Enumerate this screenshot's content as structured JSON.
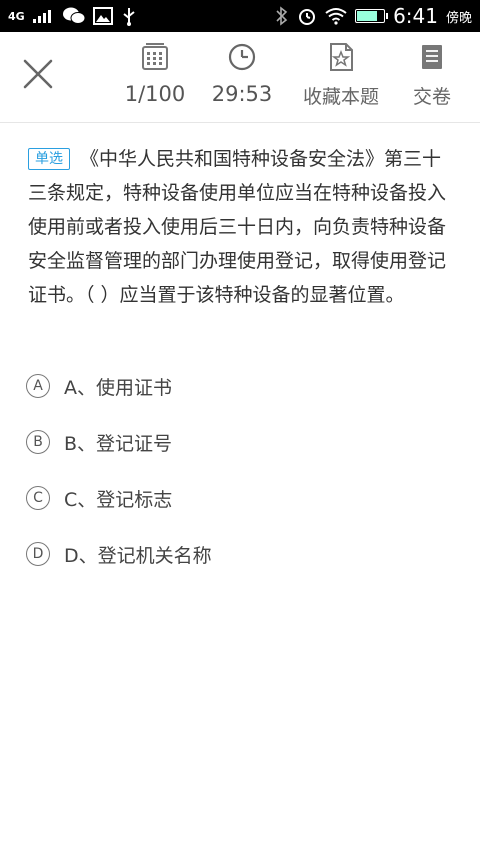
{
  "statusbar": {
    "network": "4G",
    "time": "6:41",
    "ampm": "傍晚",
    "battery_level": 0.85
  },
  "toolbar": {
    "progress": "1/100",
    "timer": "29:53",
    "favorite_label": "收藏本题",
    "submit_label": "交卷"
  },
  "question": {
    "type_tag": "单选",
    "text": "《中华人民共和国特种设备安全法》第三十三条规定，特种设备使用单位应当在特种设备投入使用前或者投入使用后三十日内，向负责特种设备安全监督管理的部门办理使用登记，取得使用登记证书。（ ）应当置于该特种设备的显著位置。"
  },
  "options": [
    {
      "letter": "A",
      "text": "A、使用证书"
    },
    {
      "letter": "B",
      "text": "B、登记证号"
    },
    {
      "letter": "C",
      "text": "C、登记标志"
    },
    {
      "letter": "D",
      "text": "D、登记机关名称"
    }
  ],
  "colors": {
    "accent": "#2a9fe0",
    "statusbar_bg": "#000000"
  }
}
